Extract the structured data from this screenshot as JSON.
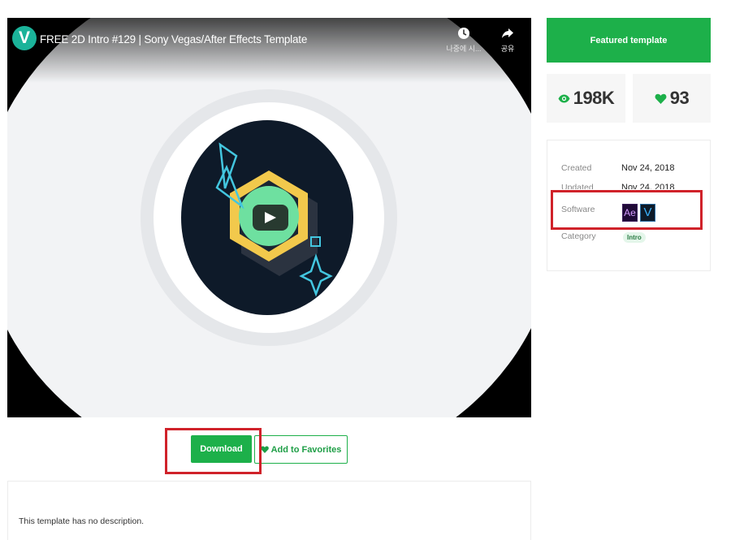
{
  "video": {
    "channel_initial": "V",
    "title": "FREE 2D Intro #129 | Sony Vegas/After Effects Template",
    "watch_later_label": "나중에 시...",
    "share_label": "공유"
  },
  "actions": {
    "download_label": "Download",
    "favorite_label": "Add to Favorites"
  },
  "description": {
    "text": "This template has no description."
  },
  "sidebar": {
    "featured_label": "Featured template",
    "stats": {
      "views": "198K",
      "likes": "93"
    },
    "info": {
      "created_label": "Created",
      "created_value": "Nov 24, 2018",
      "updated_label": "Updated",
      "updated_value": "Nov 24, 2018",
      "software_label": "Software",
      "software": [
        "Ae",
        "V"
      ],
      "category_label": "Category",
      "category_value": "Intro"
    }
  },
  "colors": {
    "brand_green": "#1db04a",
    "highlight_red": "#d0222a",
    "video_bg": "#f2f3f5",
    "circle_dark": "#0e1a29",
    "hexagon_yellow": "#f2c94c",
    "play_green": "#6ee0a0",
    "accent_cyan": "#43c6df"
  }
}
